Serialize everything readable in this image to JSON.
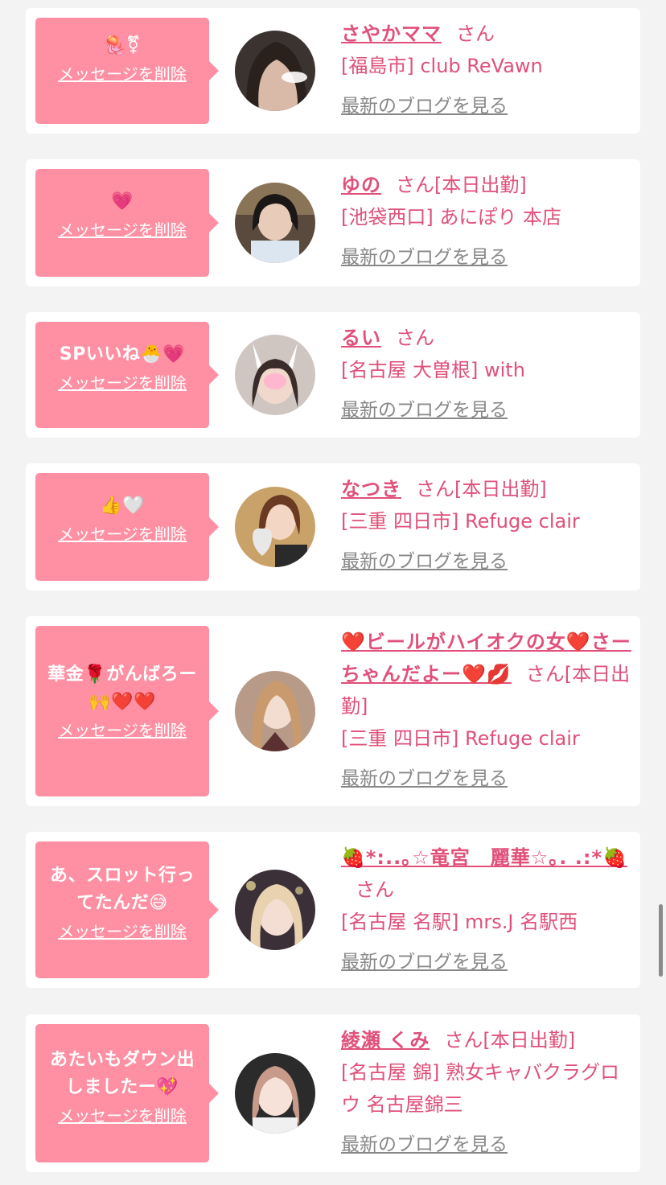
{
  "delete_label": "メッセージを削除",
  "blog_label": "最新のブログを見る",
  "san_label": "さん",
  "colors": {
    "bubble": "#ff8fa3",
    "accent": "#e0507a",
    "blog_link": "#888888",
    "background": "#f3f3f3"
  },
  "cards": [
    {
      "message": "🪼⚧",
      "name": "さやかママ",
      "status": "",
      "shop": "[福島市] club ReVawn",
      "avatar": "woman-avatar-1"
    },
    {
      "message": "💗",
      "name": "ゆの",
      "status": "[本日出勤]",
      "shop": "[池袋西口] あにぽり 本店",
      "avatar": "woman-avatar-2"
    },
    {
      "message": "SPいいね🐣💗",
      "name": "るい",
      "status": "",
      "shop": "[名古屋 大曽根] with",
      "avatar": "woman-avatar-3"
    },
    {
      "message": "👍🤍",
      "name": "なつき",
      "status": "[本日出勤]",
      "shop": "[三重 四日市] Refuge clair",
      "avatar": "woman-avatar-4"
    },
    {
      "message": "華金🌹がんばろー\n🙌❤️❤️",
      "name": "❤️ビールがハイオクの女❤️さーちゃんだよー❤️💋",
      "status": "[本日出勤]",
      "shop": "[三重 四日市] Refuge clair",
      "avatar": "woman-avatar-5"
    },
    {
      "message": "あ、スロット行っ\nてたんだ😅",
      "name": "🍓*:..｡☆竜宮　麗華☆｡. .:*🍓",
      "status": "",
      "shop": "[名古屋 名駅] mrs.J 名駅西",
      "avatar": "woman-avatar-6"
    },
    {
      "message": "あたいもダウン出\nしましたー💖",
      "name": "綾瀬 くみ",
      "status": "[本日出勤]",
      "shop": "[名古屋 錦] 熟女キャバクラグロウ 名古屋錦三",
      "avatar": "woman-avatar-7"
    }
  ]
}
